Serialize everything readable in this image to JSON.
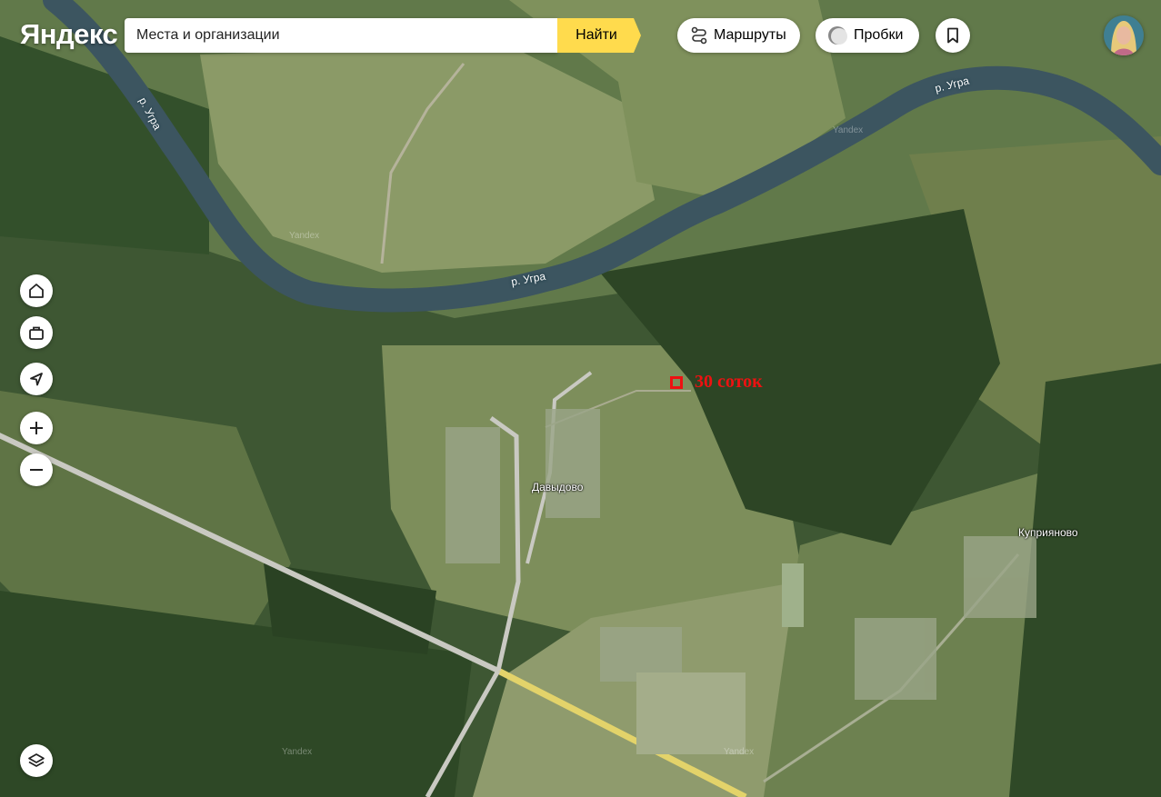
{
  "header": {
    "logo": "Яндекс",
    "search": {
      "placeholder": "Места и организации",
      "value": ""
    },
    "find_label": "Найти",
    "routes_label": "Маршруты",
    "traffic_label": "Пробки"
  },
  "map": {
    "river_labels": [
      "р. Угра",
      "р. Угра",
      "р. Угра"
    ],
    "places": {
      "village_1": "Давыдово",
      "village_2": "Куприяново"
    },
    "watermark": "Yandex",
    "plot_annotation": "30 соток"
  },
  "controls": [
    {
      "name": "home-icon"
    },
    {
      "name": "briefcase-icon"
    },
    {
      "name": "location-arrow-icon"
    },
    {
      "name": "zoom-in-icon"
    },
    {
      "name": "zoom-out-icon"
    },
    {
      "name": "layers-icon"
    }
  ],
  "colors": {
    "accent": "#ffdb4d",
    "annotation": "#ee1111",
    "river": "#3c5560"
  }
}
